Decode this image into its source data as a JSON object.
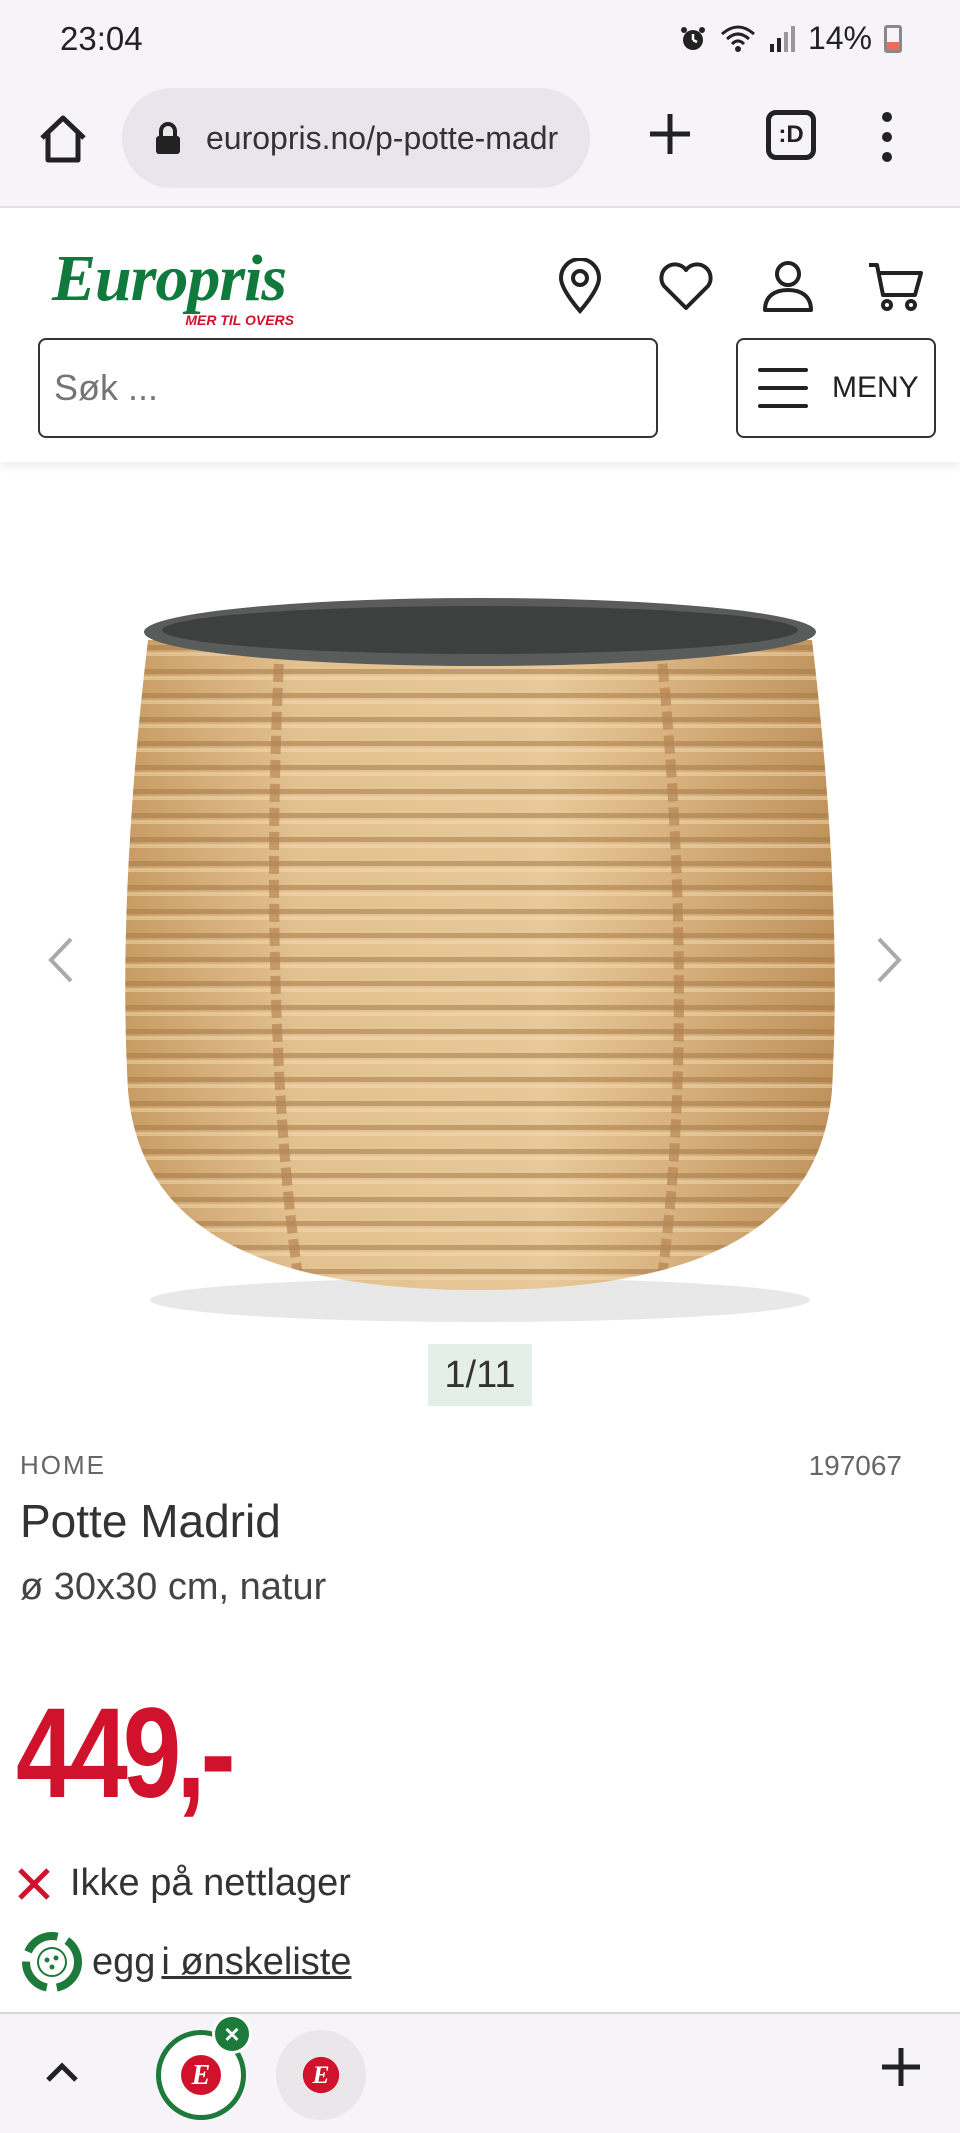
{
  "status_bar": {
    "time": "23:04",
    "battery": "14%",
    "icons": [
      "alarm-icon",
      "wifi-icon",
      "signal-icon",
      "battery-icon"
    ]
  },
  "browser": {
    "url": "europris.no/p-potte-madr",
    "tabs_label": ":D"
  },
  "header": {
    "logo_text": "Europris",
    "logo_tagline": "MER TIL OVERS",
    "search_placeholder": "Søk ...",
    "menu_label": "MENY",
    "icons": [
      "location-pin-icon",
      "heart-icon",
      "user-icon",
      "cart-icon"
    ]
  },
  "gallery": {
    "counter": "1/11"
  },
  "product": {
    "brand": "HOME",
    "sku": "197067",
    "title": "Potte Madrid",
    "subtitle": "ø 30x30 cm, natur",
    "price": "449,-",
    "stock_status": "Ikke på nettlager",
    "wishlist_prefix": "egg",
    "wishlist_link": " i ønskeliste"
  },
  "colors": {
    "brand_green": "#0f7a3c",
    "price_red": "#d0122d",
    "counter_bg": "#e4efe9"
  }
}
